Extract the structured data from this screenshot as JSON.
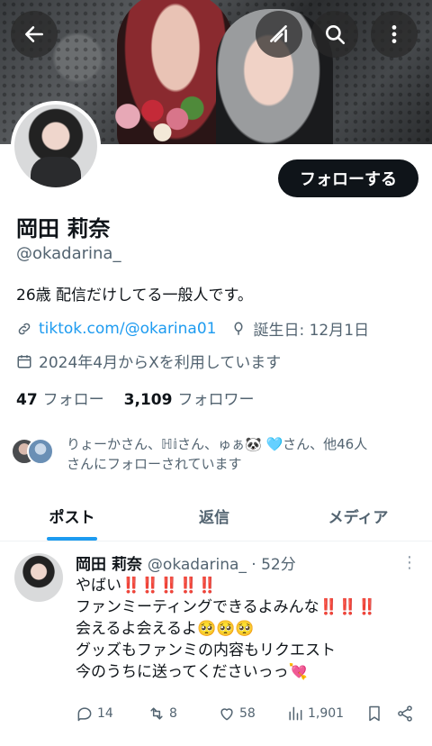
{
  "profile": {
    "name": "岡田 莉奈",
    "handle": "@okadarina_",
    "bio": "26歳 配信だけしてる一般人です。",
    "link": "tiktok.com/@okarina01",
    "birthday": "誕生日: 12月1日",
    "joined": "2024年4月からXを利用しています",
    "following_count": "47",
    "following_label": "フォロー",
    "followers_count": "3,109",
    "followers_label": "フォロワー",
    "followed_by_line1": "りょーかさん、ℍ𝕚さん、ゅぁ🐼 🩵さん、他46人",
    "followed_by_line2": "さんにフォローされています",
    "follow_button": "フォローする"
  },
  "tabs": [
    {
      "label": "ポスト",
      "active": true
    },
    {
      "label": "返信",
      "active": false
    },
    {
      "label": "メディア",
      "active": false
    }
  ],
  "post": {
    "author": "岡田 莉奈",
    "handle_time": "@okadarina_ · 52分",
    "lines": [
      "やばい‼️‼️‼️‼️‼️",
      "ファンミーティングできるよみんな‼️‼️‼️",
      "会えるよ会えるよ🥺🥺🥺",
      "グッズもファンミの内容もリクエスト",
      "今のうちに送ってくださいっっ💘"
    ],
    "replies": "14",
    "reposts": "8",
    "likes": "58",
    "views": "1,901"
  },
  "icons": {
    "back": "arrow-left-icon",
    "grok": "grok-icon",
    "search": "search-icon",
    "more": "more-vertical-icon"
  },
  "colors": {
    "accent": "#1d9bf0",
    "text": "#0f1419",
    "muted": "#536471"
  }
}
